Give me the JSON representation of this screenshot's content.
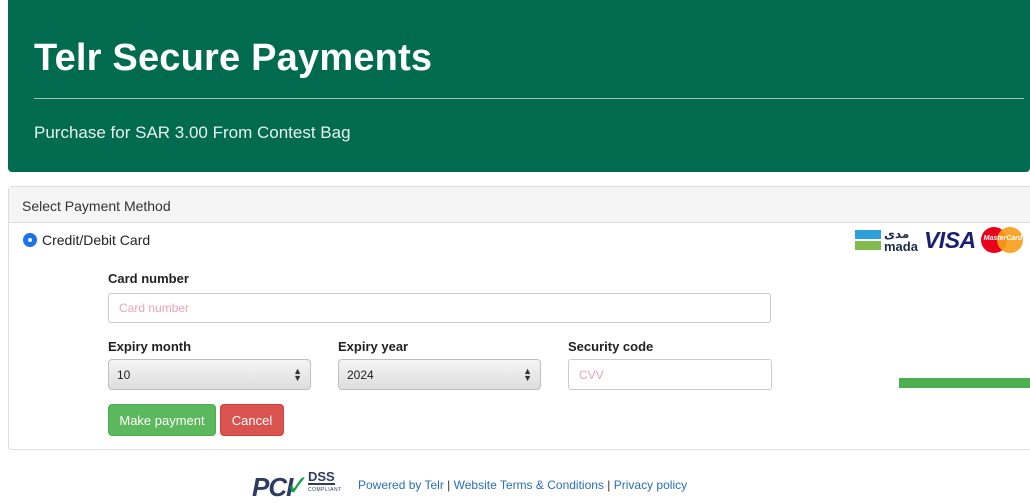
{
  "header": {
    "title": "Telr Secure Payments",
    "subtitle": "Purchase for SAR 3.00 From Contest Bag"
  },
  "panel": {
    "heading": "Select Payment Method",
    "method_label": "Credit/Debit Card"
  },
  "logos": {
    "mada_ar": "مدى",
    "mada_en": "mada",
    "visa": "VISA",
    "mastercard": "MasterCard"
  },
  "form": {
    "card_number_label": "Card number",
    "card_number_placeholder": "Card number",
    "expiry_month_label": "Expiry month",
    "expiry_month_value": "10",
    "expiry_year_label": "Expiry year",
    "expiry_year_value": "2024",
    "security_code_label": "Security code",
    "security_code_placeholder": "CVV"
  },
  "buttons": {
    "make_payment": "Make payment",
    "cancel": "Cancel"
  },
  "footer": {
    "pci_text": "PCI",
    "dss_text": "DSS",
    "compliant_text": "COMPLIANT",
    "powered_by": "Powered by Telr",
    "terms": "Website Terms & Conditions",
    "privacy": "Privacy policy",
    "separator": "|"
  },
  "colors": {
    "header_bg": "#006b4f",
    "primary_button": "#5cb85c",
    "danger_button": "#d9534f",
    "link": "#2a6ebb"
  }
}
